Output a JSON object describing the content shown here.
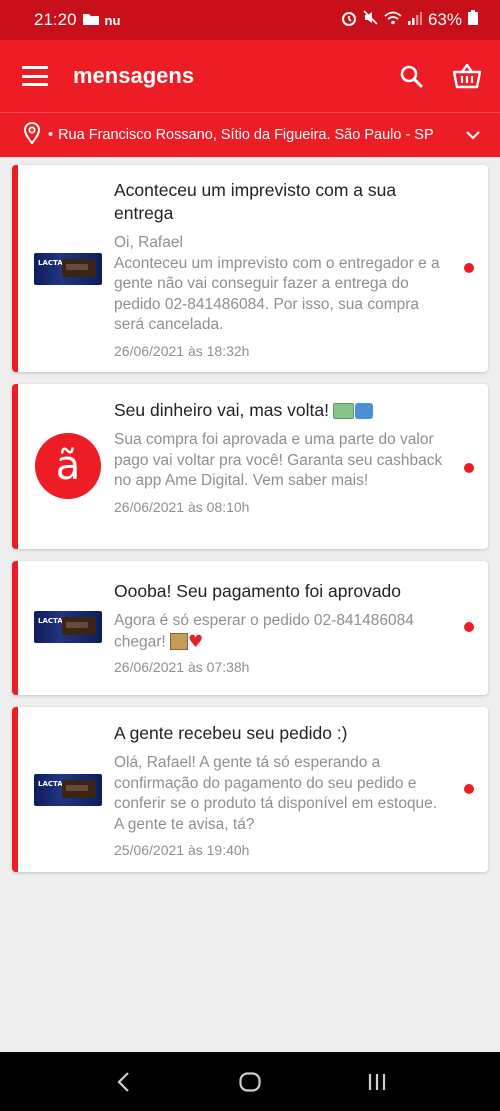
{
  "status_bar": {
    "time": "21:20",
    "carrier": "nu",
    "battery": "63%"
  },
  "header": {
    "title": "mensagens",
    "menu_icon": "hamburger-menu-icon",
    "search_icon": "search-icon",
    "basket_icon": "basket-icon"
  },
  "location": {
    "icon": "location-pin-icon",
    "text": "Rua Francisco Rossano, Sítio da Figueira. São Paulo - SP"
  },
  "messages": [
    {
      "title": "Aconteceu um imprevisto com a sua entrega",
      "body": "Oi, Rafael\n Aconteceu um imprevisto com o entregador e a gente não vai conseguir fazer a entrega do pedido 02-841486084. Por isso, sua compra será cancelada.",
      "date": "26/06/2021 às 18:32h",
      "image": "lacta-chocolate-thumbnail",
      "unread": true
    },
    {
      "title": "Seu dinheiro vai, mas volta!",
      "body": "Sua compra foi aprovada e uma parte do valor pago vai voltar pra você! Garanta seu cashback no app Ame Digital. Vem saber mais!",
      "date": "26/06/2021 às 08:10h",
      "image": "ame-logo",
      "logo_letter": "ã",
      "unread": true
    },
    {
      "title": "Oooba! Seu pagamento foi aprovado",
      "body": "Agora é só esperar o pedido 02-841486084 chegar!",
      "date": "26/06/2021 às 07:38h",
      "image": "lacta-chocolate-thumbnail",
      "unread": true
    },
    {
      "title": "A gente recebeu seu pedido :)",
      "body": "Olá, Rafael! A gente tá só esperando a confirmação do pagamento do seu pedido e conferir se o produto tá disponível em estoque. A gente te avisa, tá?",
      "date": "25/06/2021 às 19:40h",
      "image": "lacta-chocolate-thumbnail",
      "unread": true
    }
  ],
  "nav": {
    "back_icon": "back-icon",
    "home_icon": "home-icon",
    "recents_icon": "recents-icon"
  },
  "colors": {
    "brand_red": "#ee1c25",
    "status_red": "#c8101a"
  }
}
